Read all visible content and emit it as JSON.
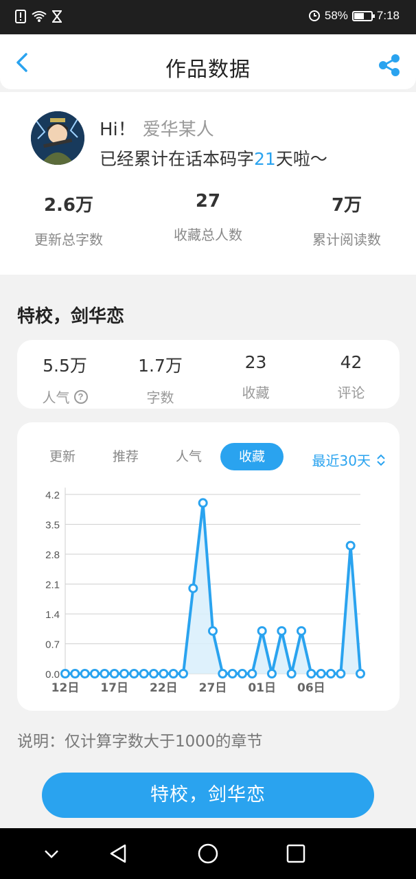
{
  "status_bar": {
    "icons": [
      "alert-icon",
      "wifi-icon",
      "hourglass-icon",
      "data-saver-icon",
      "battery-icon"
    ],
    "battery": "58%",
    "battery_level": 0.58,
    "time": "7:18"
  },
  "header": {
    "title": "作品数据",
    "back_icon": "chevron-left-icon",
    "share_icon": "share-icon"
  },
  "profile": {
    "greeting": "Hi！",
    "username": "爱华某人",
    "days_prefix": "已经累计在话本码字",
    "days": "21",
    "days_suffix": "天啦～"
  },
  "summary_stats": [
    {
      "value": "2.6万",
      "label": "更新总字数"
    },
    {
      "value": "27",
      "label": "收藏总人数"
    },
    {
      "value": "7万",
      "label": "累计阅读数"
    }
  ],
  "work": {
    "title": "特校，剑华恋",
    "stats": [
      {
        "value": "5.5万",
        "label": "人气"
      },
      {
        "value": "1.7万",
        "label": "字数"
      },
      {
        "value": "23",
        "label": "收藏"
      },
      {
        "value": "42",
        "label": "评论"
      }
    ]
  },
  "chart_tabs": [
    "更新",
    "推荐",
    "人气",
    "收藏"
  ],
  "active_tab": "收藏",
  "range_label": "最近30天",
  "colors": {
    "accent": "#2aa3ef",
    "area_fill": "#d8eefc"
  },
  "chart_data": {
    "type": "area",
    "x": [
      "12日",
      "13日",
      "14日",
      "15日",
      "16日",
      "17日",
      "18日",
      "19日",
      "20日",
      "21日",
      "22日",
      "23日",
      "24日",
      "25日",
      "26日",
      "27日",
      "28日",
      "29日",
      "30日",
      "31日",
      "01日",
      "02日",
      "03日",
      "04日",
      "05日",
      "06日",
      "07日",
      "08日",
      "09日",
      "10日",
      "11日"
    ],
    "values": [
      0,
      0,
      0,
      0,
      0,
      0,
      0,
      0,
      0,
      0,
      0,
      0,
      0,
      2,
      4,
      1,
      0,
      0,
      0,
      0,
      1,
      0,
      1,
      0,
      1,
      0,
      0,
      0,
      0,
      3,
      0
    ],
    "x_ticks": [
      "12日",
      "17日",
      "22日",
      "27日",
      "01日",
      "06日"
    ],
    "y_ticks": [
      "0.0",
      "0.7",
      "1.4",
      "2.1",
      "2.8",
      "3.5",
      "4.2"
    ],
    "ylim": [
      0,
      4.2
    ],
    "grid": true
  },
  "note": "说明：仅计算字数大于1000的章节",
  "primary_button": "特校，剑华恋",
  "nav_bar": [
    "chevron-down-icon",
    "back-triangle-icon",
    "home-circle-icon",
    "recents-square-icon"
  ]
}
